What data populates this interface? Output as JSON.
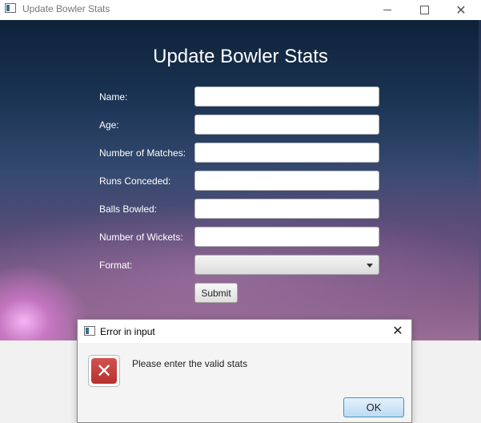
{
  "window": {
    "title": "Update Bowler Stats",
    "minimize_icon": "minimize-icon",
    "maximize_icon": "maximize-icon",
    "close_symbol": "✕"
  },
  "form": {
    "heading": "Update Bowler Stats",
    "fields": [
      {
        "label": "Name:",
        "value": ""
      },
      {
        "label": "Age:",
        "value": ""
      },
      {
        "label": "Number of Matches:",
        "value": ""
      },
      {
        "label": "Runs Conceded:",
        "value": ""
      },
      {
        "label": "Balls Bowled:",
        "value": ""
      },
      {
        "label": "Number of Wickets:",
        "value": ""
      }
    ],
    "format_label": "Format:",
    "format_selected": "",
    "submit_label": "Submit"
  },
  "dialog": {
    "title": "Error in input",
    "message": "Please enter the valid stats",
    "ok_label": "OK",
    "close_symbol": "✕",
    "error_icon": "error-x-icon",
    "error_symbol": "✕"
  },
  "colors": {
    "error_red": "#c0403d",
    "ok_border": "#3f93c9",
    "form_text": "#ffffff"
  }
}
